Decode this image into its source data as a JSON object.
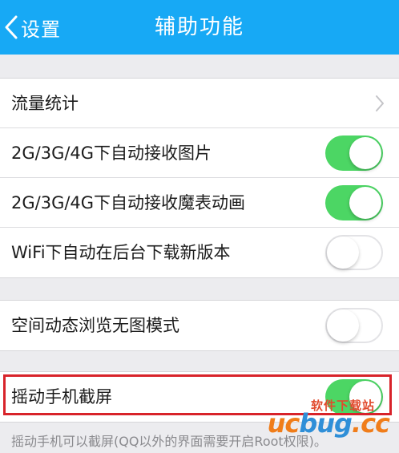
{
  "nav": {
    "back_label": "设置",
    "title": "辅助功能"
  },
  "groups": [
    {
      "items": [
        {
          "label": "流量统计",
          "control": "chevron"
        },
        {
          "label": "2G/3G/4G下自动接收图片",
          "control": "toggle",
          "on": true
        },
        {
          "label": "2G/3G/4G下自动接收魔表动画",
          "control": "toggle",
          "on": true
        },
        {
          "label": "WiFi下自动在后台下载新版本",
          "control": "toggle",
          "on": false
        }
      ]
    },
    {
      "items": [
        {
          "label": "空间动态浏览无图模式",
          "control": "toggle",
          "on": false
        }
      ]
    },
    {
      "items": [
        {
          "label": "摇动手机截屏",
          "control": "toggle",
          "on": true
        }
      ]
    }
  ],
  "footnote": "摇动手机可以截屏(QQ以外的界面需要开启Root权限)。",
  "watermark": {
    "line1": "软件下载站",
    "line2_orange": "uc",
    "line2_blue": "bug",
    "line2_tail": ".cc"
  },
  "colors": {
    "nav_bg": "#17a9f5",
    "toggle_on": "#4cd664",
    "highlight": "#d8232a"
  }
}
